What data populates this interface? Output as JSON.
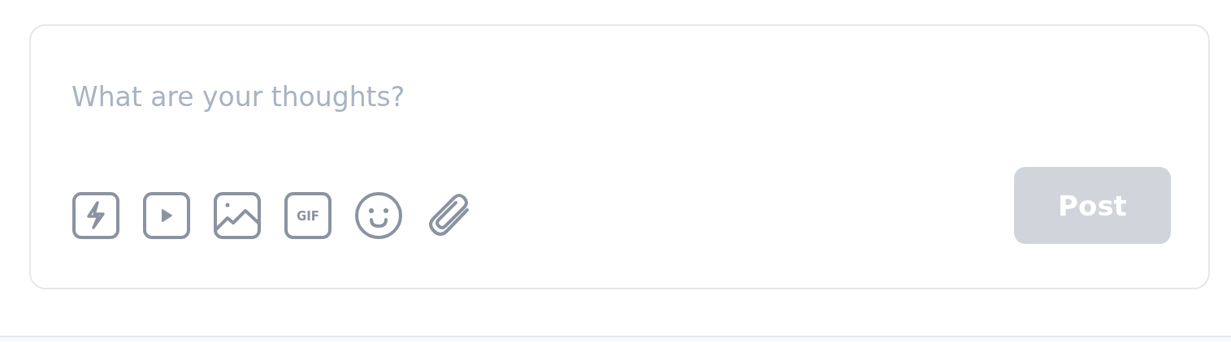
{
  "composer": {
    "placeholder": "What are your thoughts?",
    "tools": [
      {
        "kind": "bolt"
      },
      {
        "kind": "video"
      },
      {
        "kind": "image"
      },
      {
        "kind": "gif",
        "label": "GIF"
      },
      {
        "kind": "emoji"
      },
      {
        "kind": "attach"
      }
    ],
    "post_button": {
      "label": "Post",
      "disabled": true
    }
  }
}
